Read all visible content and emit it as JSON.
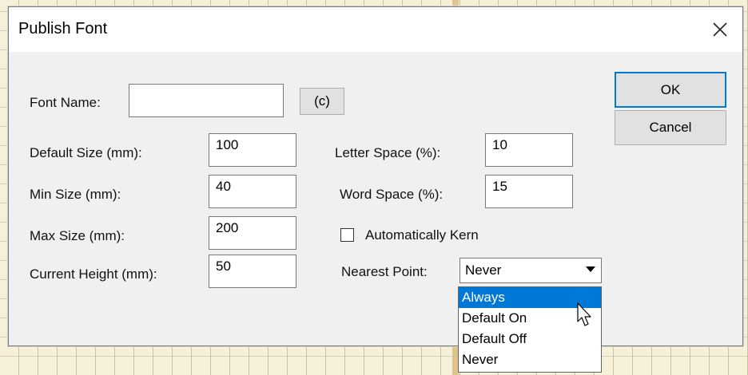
{
  "window": {
    "title": "Publish Font"
  },
  "form": {
    "font_name_label": "Font Name:",
    "font_name_value": "",
    "copyright_button": "(c)",
    "default_size_label": "Default Size (mm):",
    "default_size_value": "100",
    "min_size_label": "Min Size (mm):",
    "min_size_value": "40",
    "max_size_label": "Max Size (mm):",
    "max_size_value": "200",
    "current_height_label": "Current Height (mm):",
    "current_height_value": "50",
    "letter_space_label": "Letter Space (%):",
    "letter_space_value": "10",
    "word_space_label": "Word Space (%):",
    "word_space_value": "15",
    "auto_kern_label": "Automatically Kern",
    "auto_kern_checked": false,
    "nearest_point_label": "Nearest Point:",
    "nearest_point_value": "Never",
    "nearest_point_options": [
      "Always",
      "Default On",
      "Default Off",
      "Never"
    ],
    "nearest_point_highlighted": "Always"
  },
  "buttons": {
    "ok": "OK",
    "cancel": "Cancel"
  },
  "icons": {
    "close": "close-icon",
    "dropdown": "chevron-down-icon",
    "cursor": "mouse-pointer-icon"
  },
  "colors": {
    "selection": "#0078d7",
    "dialog_bg": "#f0f0f0",
    "backdrop": "#f6f0d9"
  }
}
